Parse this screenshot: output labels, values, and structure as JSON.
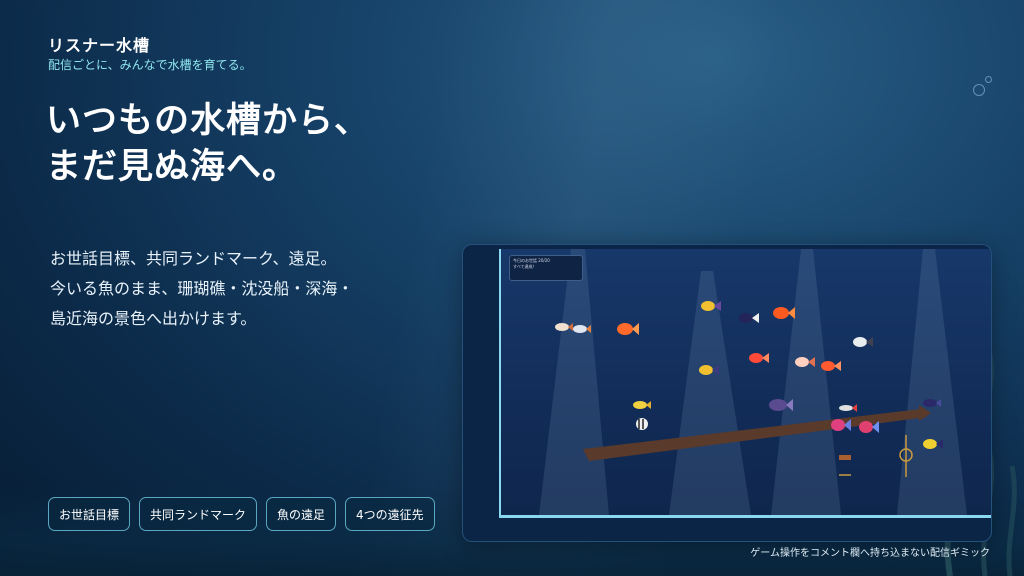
{
  "brand": {
    "title": "リスナー水槽",
    "tagline": "配信ごとに、みんなで水槽を育てる。"
  },
  "headline": {
    "line1": "いつもの水槽から、",
    "line2": "まだ見ぬ海へ。"
  },
  "description": {
    "line1": "お世話目標、共同ランドマーク、遠足。",
    "line2": "今いる魚のまま、珊瑚礁・沈没船・深海・",
    "line3": "島近海の景色へ出かけます。"
  },
  "chips": [
    "お世話目標",
    "共同ランドマーク",
    "魚の遠足",
    "4つの遠征先"
  ],
  "preview": {
    "goal_title": "今日のお世話 20/20",
    "goal_status": "すべて達成！"
  },
  "caption": "ゲーム操作をコメント欄へ持ち込まない配信ギミック",
  "colors": {
    "accent": "#8fe6ef",
    "chip_border": "#5aa7c2",
    "background": "#0c2b4a",
    "tank_border": "#8ad8f0"
  }
}
